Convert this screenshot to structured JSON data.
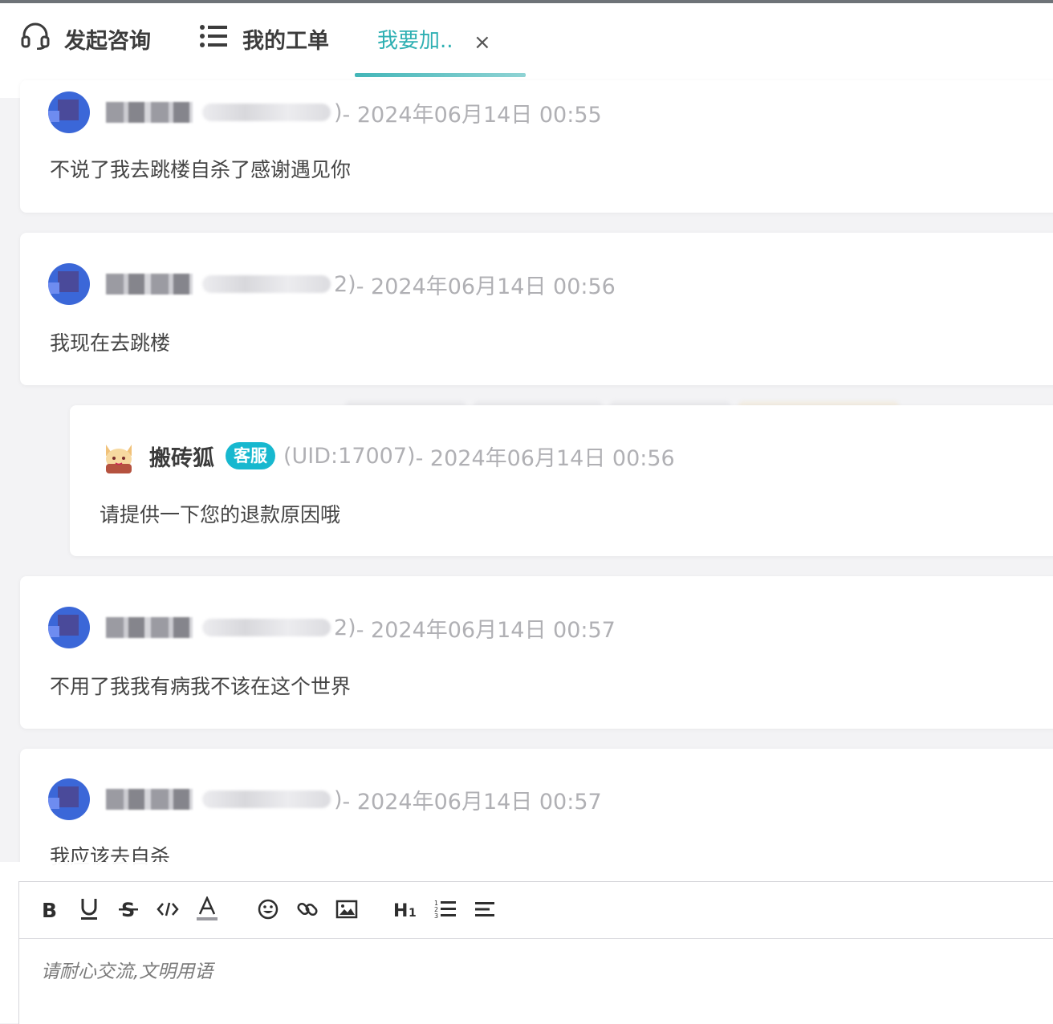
{
  "tabs": [
    {
      "label": "发起咨询",
      "icon": "headset-icon"
    },
    {
      "label": "我的工单",
      "icon": "list-icon"
    },
    {
      "label": "我要加..",
      "icon": "",
      "active": true,
      "close": "×"
    }
  ],
  "messages": [
    {
      "uid_tail": ")",
      "time": " - 2024年06月14日 00:55",
      "text": "不说了我去跳楼自杀了感谢遇见你"
    },
    {
      "uid_tail": "2)",
      "time": " - 2024年06月14日 00:56",
      "text": "我现在去跳楼"
    },
    {
      "staff": true,
      "name": "搬砖狐",
      "badge": "客服",
      "uid": "(UID:17007)",
      "time": " - 2024年06月14日 00:56",
      "text": "请提供一下您的退款原因哦"
    },
    {
      "uid_tail": "2)",
      "time": " - 2024年06月14日 00:57",
      "text": "不用了我我有病我不该在这个世界"
    },
    {
      "uid_tail": ")",
      "time": " - 2024年06月14日 00:57",
      "text": "我应该去自杀"
    }
  ],
  "editor": {
    "placeholder": "请耐心交流,文明用语",
    "tools": [
      "bold-icon",
      "underline-icon",
      "strikethrough-icon",
      "code-icon",
      "font-color-icon",
      "emoji-icon",
      "link-icon",
      "image-icon",
      "heading-icon",
      "ordered-list-icon",
      "align-icon"
    ]
  },
  "colors": {
    "accent": "#2fb0b3",
    "badge": "#17b8cf"
  }
}
